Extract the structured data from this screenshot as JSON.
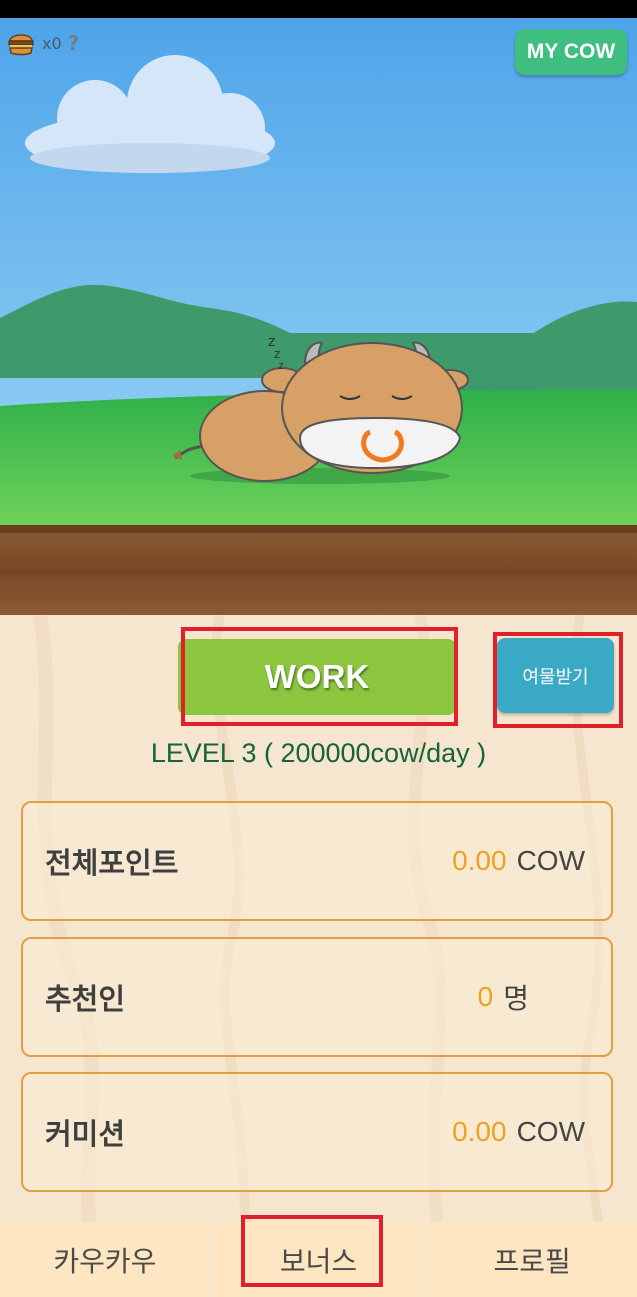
{
  "topbar": {
    "count": "x0",
    "help": "?",
    "my_cow_label": "MY COW"
  },
  "actions": {
    "work_label": "WORK",
    "gift_label": "여물받기"
  },
  "level_text": "LEVEL  3 ( 200000cow/day )",
  "stats": [
    {
      "label": "전체포인트",
      "value": "0.00",
      "unit": "COW"
    },
    {
      "label": "추천인",
      "value": "0",
      "unit": "명"
    },
    {
      "label": "커미션",
      "value": "0.00",
      "unit": "COW"
    }
  ],
  "tabs": [
    {
      "label": "카우카우"
    },
    {
      "label": "보너스"
    },
    {
      "label": "프로필"
    }
  ],
  "icons": {
    "currency": "burger-icon",
    "help": "help-icon",
    "sleep": "zzz-icon"
  },
  "colors": {
    "work_button": "#8cc63f",
    "gift_button": "#3aa9c6",
    "my_cow_button": "#3fbf7f",
    "highlight": "#e0202a",
    "level_text": "#14633a",
    "value_number": "#f0a020"
  }
}
